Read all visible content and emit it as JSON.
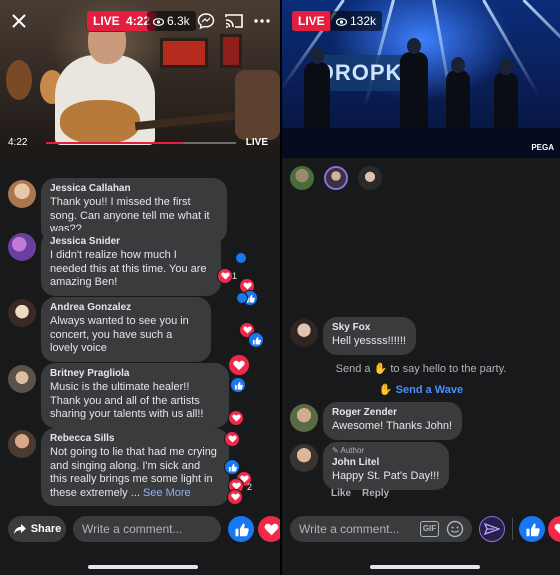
{
  "left": {
    "live_label": "LIVE",
    "live_time": "4:22",
    "views": "6.3k",
    "elapsed": "4:22",
    "progress_live_label": "LIVE",
    "progress_fraction": 0.72,
    "comments": [
      {
        "name": "Jessica Callahan",
        "text": "Thank you!! I missed the first song. Can anyone tell me what it was??"
      },
      {
        "name": "Jessica Snider",
        "text": "I didn't realize how much I needed this at this time. You are amazing Ben!"
      },
      {
        "name": "Andrea Gonzalez",
        "text": "Always wanted to see you in concert, you have such a lovely voice"
      },
      {
        "name": "Britney Pragliola",
        "text": "Music is the ultimate healer!! Thank you and all of the artists sharing your talents with us all!!"
      },
      {
        "name": "Rebecca Sills",
        "text": "Not going to lie that had me crying and singing along. I'm sick and this really brings me some light in these extremely ...",
        "see_more": "See More"
      }
    ],
    "reaction_counts": [
      "1",
      "2"
    ],
    "share_label": "Share",
    "comment_placeholder": "Write a comment...",
    "icons": [
      "close-icon",
      "comment-icon",
      "cast-icon",
      "more-icon",
      "share-icon",
      "like-icon",
      "heart-icon"
    ]
  },
  "right": {
    "live_label": "LIVE",
    "views": "132k",
    "banner_text": "DROPKICK",
    "watermark": "PEGA",
    "comments": [
      {
        "name": "Sky Fox",
        "text": "Hell yessss!!!!!!"
      },
      {
        "name": "Roger Zender",
        "text": "Awesome!  Thanks John!"
      },
      {
        "author_tag": "Author",
        "name": "John Litel",
        "text": "Happy St. Pat's Day!!!",
        "actions": [
          "Like",
          "Reply"
        ]
      }
    ],
    "system_message_before": "Send a",
    "system_message_after": "to say hello to the party.",
    "wave_label": "Send a Wave",
    "comment_placeholder": "Write a comment...",
    "gif_label": "GIF",
    "icons": [
      "wave-hand-icon",
      "gif-icon",
      "emoji-icon",
      "send-icon",
      "like-icon",
      "heart-icon"
    ]
  },
  "colors": {
    "live_red": "#e41e3f",
    "like_blue": "#1877f2",
    "heart_red": "#f0284a",
    "bubble": "#3a3b3c",
    "background": "#18191a"
  }
}
